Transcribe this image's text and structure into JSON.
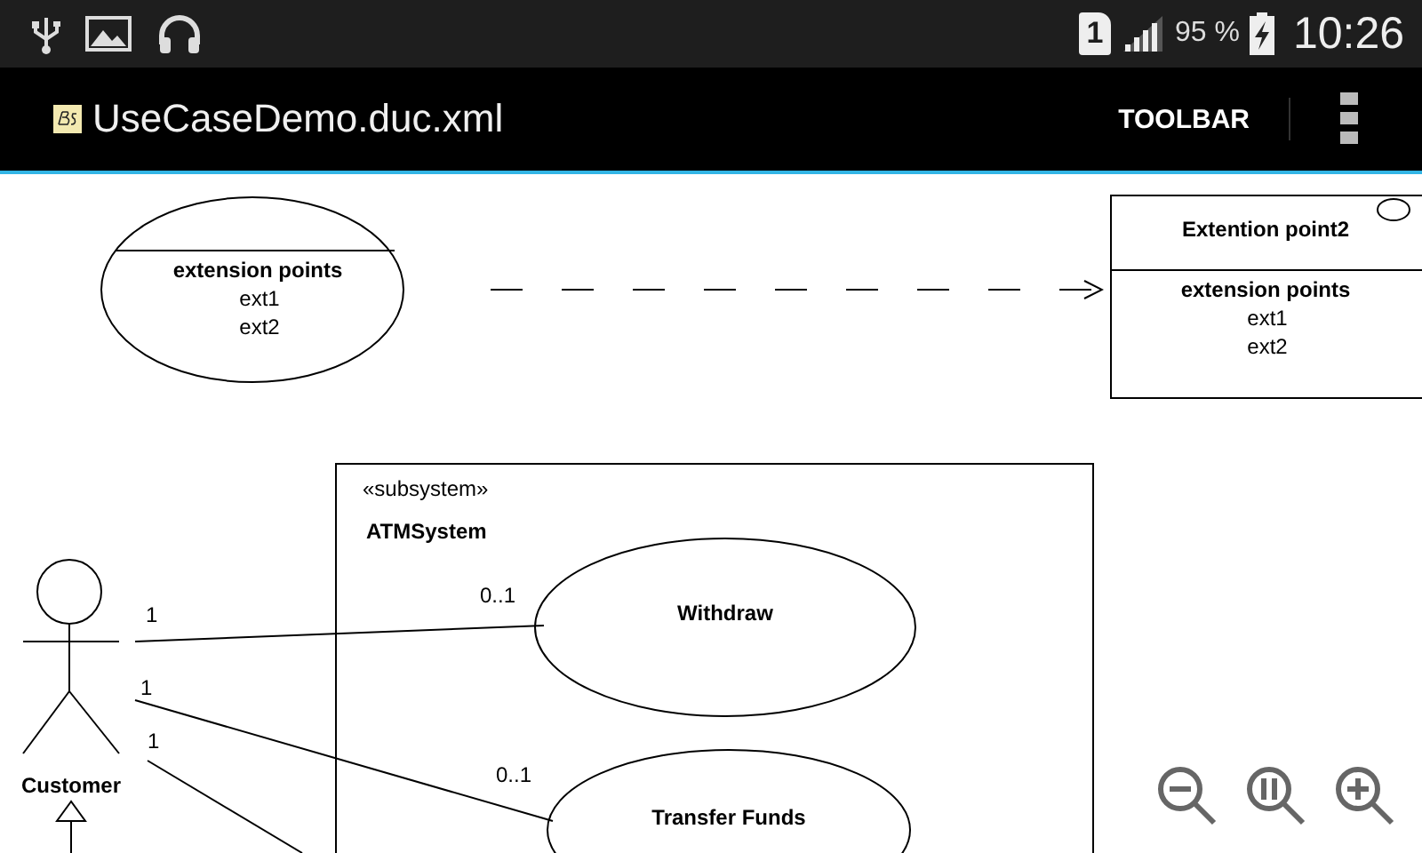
{
  "status_bar": {
    "sim_slot": "1",
    "battery_percent": "95 %",
    "time": "10:26"
  },
  "app_bar": {
    "title": "UseCaseDemo.duc.xml",
    "toolbar_button": "TOOLBAR"
  },
  "diagram": {
    "extension_use_case": {
      "heading": "extension points",
      "items": [
        "ext1",
        "ext2"
      ]
    },
    "extension_class": {
      "title": "Extention point2",
      "heading": "extension points",
      "items": [
        "ext1",
        "ext2"
      ]
    },
    "subsystem": {
      "stereotype": "«subsystem»",
      "name": "ATMSystem"
    },
    "actor": {
      "name": "Customer"
    },
    "use_cases": [
      "Withdraw",
      "Transfer Funds"
    ],
    "associations": [
      {
        "source_multiplicity": "1",
        "target_multiplicity": "0..1"
      },
      {
        "source_multiplicity": "1",
        "target_multiplicity": "0..1"
      },
      {
        "source_multiplicity": "1"
      }
    ]
  }
}
